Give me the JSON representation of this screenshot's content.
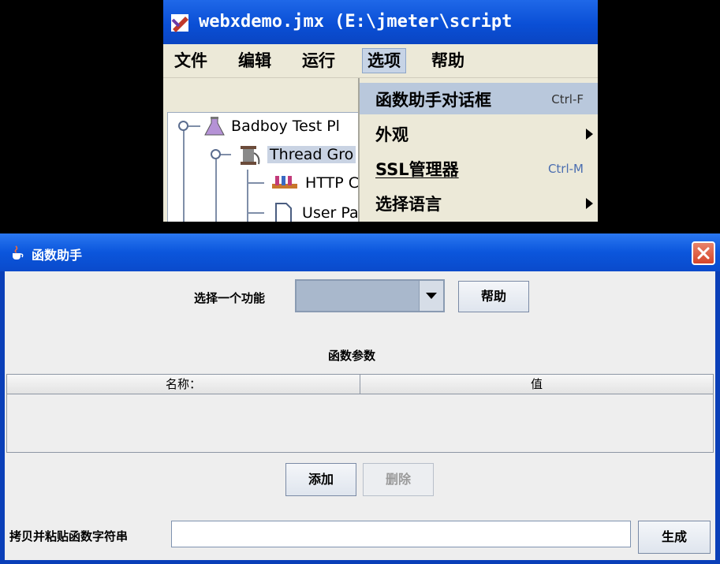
{
  "main_window": {
    "title": "webxdemo.jmx (E:\\jmeter\\script",
    "menus": [
      "文件",
      "编辑",
      "运行",
      "选项",
      "帮助"
    ],
    "active_menu_index": 3,
    "tree": [
      {
        "label": "Badboy Test Pl"
      },
      {
        "label": "Thread Gro"
      },
      {
        "label": "HTTP C"
      },
      {
        "label": "User Pa"
      }
    ],
    "options_menu": [
      {
        "label": "函数助手对话框",
        "shortcut": "Ctrl-F",
        "highlighted": true
      },
      {
        "label": "外观",
        "submenu": true
      },
      {
        "label": "SSL管理器",
        "shortcut": "Ctrl-M"
      },
      {
        "label": "选择语言",
        "submenu": true
      }
    ]
  },
  "dialog": {
    "title": "函数助手",
    "select_function_label": "选择一个功能",
    "select_function_value": "",
    "help_button": "帮助",
    "params_title": "函数参数",
    "columns": [
      "名称：",
      "值"
    ],
    "add_button": "添加",
    "delete_button": "删除",
    "copy_paste_label": "拷贝并粘贴函数字符串",
    "function_string_value": "",
    "generate_button": "生成"
  },
  "colors": {
    "titlebar": "#0a4fd6",
    "close_button": "#d5452a",
    "menu_highlight": "#b9c8dc",
    "panel_bg": "#eeeeee"
  }
}
